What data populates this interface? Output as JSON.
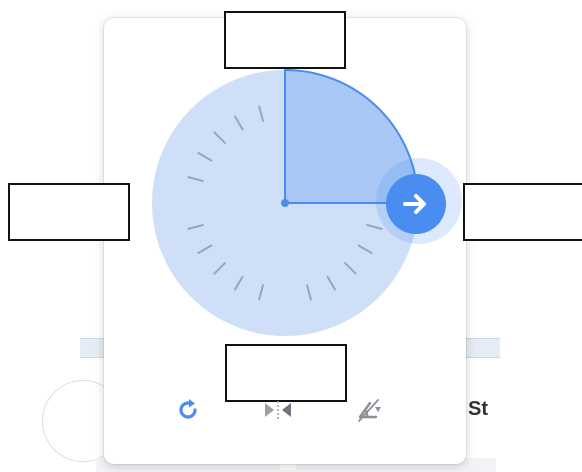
{
  "labels": {
    "top": "",
    "left": "",
    "right": "",
    "bottom": ""
  },
  "dial": {
    "angle_start_deg": 0,
    "angle_end_deg": 90,
    "fill_color": "#cfdff8",
    "sector_color": "#a9c8f5",
    "accent_color": "#4a8df0",
    "tick_color": "#9aa6b8"
  },
  "handle": {
    "icon": "arrow-right-icon"
  },
  "toolbar": {
    "rotate_icon": "rotate-clockwise-icon",
    "flip_icon": "flip-horizontal-icon",
    "reset_icon": "reset-angle-icon"
  },
  "background": {
    "partial_text": "St"
  }
}
